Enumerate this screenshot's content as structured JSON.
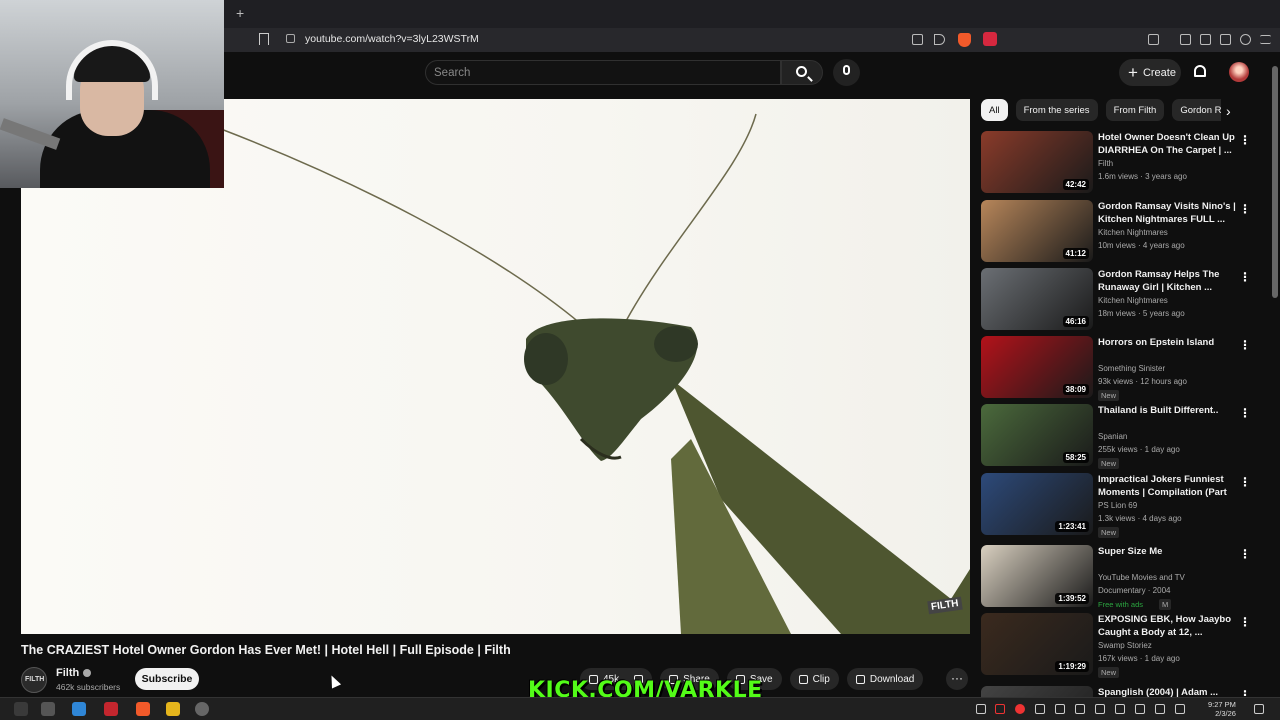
{
  "browser": {
    "new_tab": "+",
    "url": "youtube.com/watch?v=3lyL23WSTrM"
  },
  "header": {
    "search_placeholder": "Search",
    "create_label": "Create"
  },
  "video": {
    "title": "The CRAZIEST Hotel Owner Gordon Has Ever Met! | Hotel Hell | Full Episode | Filth",
    "watermark": "FILTH",
    "channel": {
      "avatar_text": "FILTH",
      "name": "Filth",
      "subscribers": "462k subscribers",
      "subscribe_label": "Subscribe"
    },
    "actions": {
      "likes": "45k",
      "share": "Share",
      "save": "Save",
      "clip": "Clip",
      "download": "Download",
      "more": "···"
    }
  },
  "overlay": {
    "kick_text": "KICK.COM/VARKLE"
  },
  "sidebar": {
    "chips": [
      "All",
      "From the series",
      "From Filth",
      "Gordon R"
    ],
    "next": "›",
    "menu": "⋮",
    "recommendations": [
      {
        "title": "Hotel Owner Doesn't Clean Up DIARRHEA On The Carpet | ...",
        "channel": "Filth",
        "meta": "1.6m views · 3 years ago",
        "duration": "42:42",
        "badge": "",
        "thumb_color": "#8a3b2a"
      },
      {
        "title": "Gordon Ramsay Visits Nino's | Kitchen Nightmares FULL ...",
        "channel": "Kitchen Nightmares",
        "meta": "10m views · 4 years ago",
        "duration": "41:12",
        "badge": "",
        "thumb_color": "#b7865a"
      },
      {
        "title": "Gordon Ramsay Helps The Runaway Girl | Kitchen ...",
        "channel": "Kitchen Nightmares",
        "meta": "18m views · 5 years ago",
        "duration": "46:16",
        "badge": "",
        "thumb_color": "#6b6f74"
      },
      {
        "title": "Horrors on Epstein Island",
        "channel": "Something Sinister",
        "meta": "93k views · 12 hours ago",
        "duration": "38:09",
        "badge": "New",
        "thumb_color": "#b3121a"
      },
      {
        "title": "Thailand is Built Different..",
        "channel": "Spanian",
        "meta": "255k views · 1 day ago",
        "duration": "58:25",
        "badge": "New",
        "thumb_color": "#4b6a3c"
      },
      {
        "title": "Impractical Jokers Funniest Moments | Compilation (Part ...",
        "channel": "PS Lion 69",
        "meta": "1.3k views · 4 days ago",
        "duration": "1:23:41",
        "badge": "New",
        "thumb_color": "#2d4a7a"
      },
      {
        "title": "Super Size Me",
        "channel": "YouTube Movies and TV",
        "meta": "Documentary · 2004",
        "duration": "1:39:52",
        "badge": "Free with ads",
        "badge2": "M",
        "thumb_color": "#d9d0c0"
      },
      {
        "title": "EXPOSING EBK, How Jaaybo Caught a Body at 12, ...",
        "channel": "Swamp Storiez",
        "meta": "167k views · 1 day ago",
        "duration": "1:19:29",
        "badge": "New",
        "thumb_color": "#3b2a1e"
      },
      {
        "title": "Spanglish (2004) | Adam ...",
        "channel": "",
        "meta": "",
        "duration": "",
        "badge": "",
        "thumb_color": "#444444"
      }
    ]
  },
  "taskbar": {
    "time": "9:27 PM",
    "date": "2/3/26"
  }
}
